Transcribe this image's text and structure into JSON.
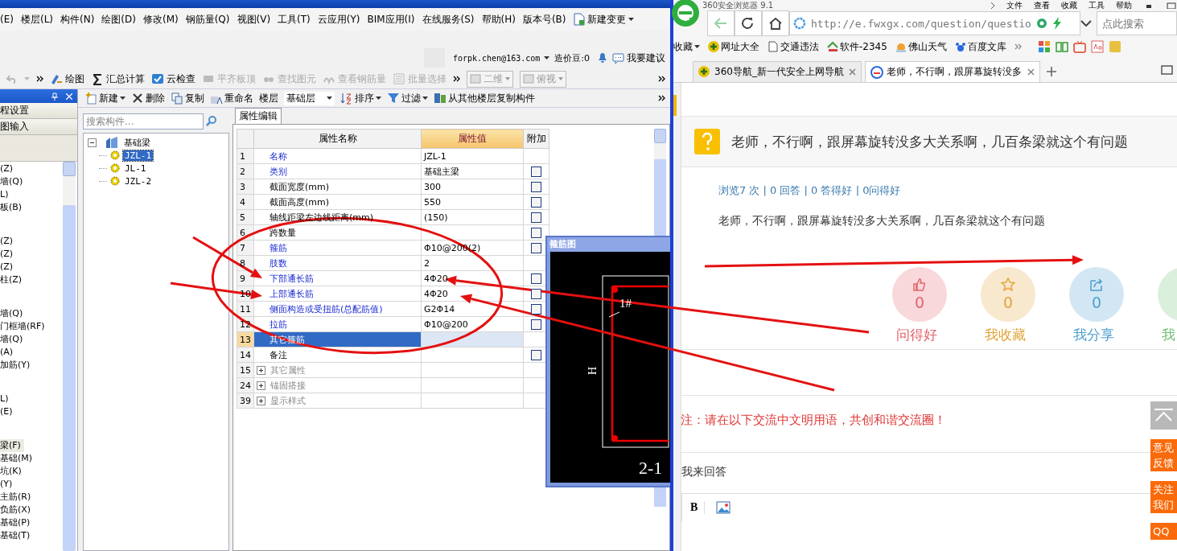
{
  "app": {
    "menu": [
      "(E)",
      "楼层(L)",
      "构件(N)",
      "绘图(D)",
      "修改(M)",
      "钢筋量(Q)",
      "视图(V)",
      "工具(T)",
      "云应用(Y)",
      "BIM应用(I)",
      "在线服务(S)",
      "帮助(H)",
      "版本号(B)"
    ],
    "menu_action": "新建变更",
    "user": {
      "email": "forpk.chen@163.com",
      "beans": "造价豆:0",
      "suggest": "我要建议"
    },
    "toolbar": [
      {
        "label": "绘图",
        "kind": "draw",
        "disabled": false
      },
      {
        "label": "汇总计算",
        "kind": "sum",
        "disabled": false
      },
      {
        "label": "云检查",
        "kind": "check",
        "disabled": false
      },
      {
        "label": "平齐板顶",
        "kind": "align",
        "disabled": true
      },
      {
        "label": "查找图元",
        "kind": "find",
        "disabled": true
      },
      {
        "label": "查看钢筋量",
        "kind": "view",
        "disabled": true
      },
      {
        "label": "批量选择",
        "kind": "batch",
        "disabled": true
      }
    ],
    "view_selects": [
      {
        "value": "二维",
        "disabled": true
      },
      {
        "value": "俯视",
        "disabled": true
      }
    ],
    "comp_toolbar": [
      {
        "label": "新建",
        "kind": "new",
        "caret": true
      },
      {
        "label": "删除",
        "kind": "delete",
        "caret": false
      },
      {
        "label": "复制",
        "kind": "copy",
        "caret": false
      },
      {
        "label": "重命名",
        "kind": "rename",
        "caret": false
      }
    ],
    "floor": {
      "label": "楼层",
      "value": "基础层"
    },
    "comp_toolbar2": [
      {
        "label": "排序",
        "kind": "sort",
        "caret": true
      },
      {
        "label": "过滤",
        "kind": "filter",
        "caret": true
      },
      {
        "label": "从其他楼层复制构件",
        "kind": "copyfloor",
        "caret": false
      }
    ],
    "nav_buttons": [
      "程设置",
      "图输入"
    ],
    "nav_groups": [
      [
        {
          "label": "(Z)",
          "selected": false
        },
        {
          "label": "墙(Q)",
          "selected": false
        },
        {
          "label": "L)",
          "selected": false
        },
        {
          "label": "板(B)",
          "selected": false
        }
      ],
      [
        {
          "label": "(Z)",
          "selected": false
        },
        {
          "label": "(Z)",
          "selected": false
        },
        {
          "label": "(Z)",
          "selected": false
        },
        {
          "label": "柱(Z)",
          "selected": false
        }
      ],
      [
        {
          "label": "墙(Q)",
          "selected": false
        },
        {
          "label": "门框墙(RF)",
          "selected": false
        },
        {
          "label": "墙(Q)",
          "selected": false
        },
        {
          "label": "(A)",
          "selected": false
        },
        {
          "label": "加筋(Y)",
          "selected": false
        }
      ],
      [
        {
          "label": "L)",
          "selected": false
        },
        {
          "label": "(E)",
          "selected": false
        }
      ],
      [
        {
          "label": "梁(F)",
          "selected": true
        },
        {
          "label": "基础(M)",
          "selected": false
        },
        {
          "label": "坑(K)",
          "selected": false
        },
        {
          "label": "(Y)",
          "selected": false
        },
        {
          "label": "主筋(R)",
          "selected": false
        },
        {
          "label": "负筋(X)",
          "selected": false
        },
        {
          "label": "基础(P)",
          "selected": false
        },
        {
          "label": "基础(T)",
          "selected": false
        }
      ]
    ],
    "search": {
      "placeholder": "搜索构件..."
    },
    "tree": {
      "label": "基础梁",
      "expanded": true,
      "children": [
        {
          "label": "JZL-1",
          "selected": true
        },
        {
          "label": "JL-1",
          "selected": false
        },
        {
          "label": "JZL-2",
          "selected": false
        }
      ]
    },
    "properties": {
      "tab": "属性编辑",
      "columns": [
        "属性名称",
        "属性值",
        "附加"
      ],
      "rows": [
        {
          "no": "1",
          "name": "名称",
          "value": "JZL-1",
          "kind": "key",
          "selected": false
        },
        {
          "no": "2",
          "name": "类别",
          "value": "基础主梁",
          "kind": "key",
          "selected": false,
          "checked": false
        },
        {
          "no": "3",
          "name": "截面宽度(mm)",
          "value": "300",
          "kind": "plain",
          "selected": false,
          "checked": false
        },
        {
          "no": "4",
          "name": "截面高度(mm)",
          "value": "550",
          "kind": "plain",
          "selected": false,
          "checked": false
        },
        {
          "no": "5",
          "name": "轴线距梁左边线距离(mm)",
          "value": "(150)",
          "kind": "plain",
          "selected": false,
          "checked": false
        },
        {
          "no": "6",
          "name": "跨数量",
          "value": "",
          "kind": "plain",
          "selected": false,
          "checked": false
        },
        {
          "no": "7",
          "name": "箍筋",
          "value": "Φ10@200(2)",
          "kind": "key",
          "selected": false,
          "checked": false
        },
        {
          "no": "8",
          "name": "肢数",
          "value": "2",
          "kind": "key",
          "selected": false
        },
        {
          "no": "9",
          "name": "下部通长筋",
          "value": "4Φ20",
          "kind": "key",
          "selected": false,
          "checked": false
        },
        {
          "no": "10",
          "name": "上部通长筋",
          "value": "4Φ20",
          "kind": "key",
          "selected": false,
          "checked": false
        },
        {
          "no": "11",
          "name": "侧面构造或受扭筋(总配筋值)",
          "value": "G2Φ14",
          "kind": "key",
          "selected": false,
          "checked": false
        },
        {
          "no": "12",
          "name": "拉筋",
          "value": "Φ10@200",
          "kind": "key",
          "selected": false,
          "checked": false
        },
        {
          "no": "13",
          "name": "其它箍筋",
          "value": "",
          "kind": "plain",
          "selected": true
        },
        {
          "no": "14",
          "name": "备注",
          "value": "",
          "kind": "plain",
          "selected": false,
          "checked": false
        },
        {
          "no": "15",
          "name": "其它属性",
          "value": "",
          "kind": "group",
          "selected": false,
          "expanded": false
        },
        {
          "no": "24",
          "name": "锚固搭接",
          "value": "",
          "kind": "group",
          "selected": false,
          "expanded": false
        },
        {
          "no": "39",
          "name": "显示样式",
          "value": "",
          "kind": "group",
          "selected": false,
          "expanded": false
        }
      ]
    },
    "stirrup": {
      "title": "箍筋图",
      "bar_label": "1#",
      "height_label": "H",
      "code": "2-1"
    }
  },
  "browser": {
    "title": "360安全浏览器 9.1",
    "menu": [
      "文件",
      "查看",
      "收藏",
      "工具",
      "帮助"
    ],
    "url": "http://e.fwxgx.com/question/questio",
    "search": {
      "placeholder": "点此搜索"
    },
    "bookmarks": [
      {
        "label": "收藏",
        "kind": "menu"
      },
      {
        "label": "网址大全",
        "kind": "nav"
      },
      {
        "label": "交通违法",
        "kind": "page"
      },
      {
        "label": "软件-2345",
        "kind": "soft"
      },
      {
        "label": "佛山天气",
        "kind": "weather"
      },
      {
        "label": "百度文库",
        "kind": "paw"
      }
    ],
    "tabs": [
      {
        "title": "360导航_新一代安全上网导航",
        "selected": false
      },
      {
        "title": "老师，不行啊，跟屏幕旋转没多",
        "selected": true
      }
    ],
    "question": {
      "title": "老师，不行啊，跟屏幕旋转没多大关系啊，几百条梁就这个有问题",
      "stats": "浏览7 次 | 0 回答 | 0 答得好 | 0问得好",
      "body": "老师，不行啊，跟屏幕旋转没多大关系啊，几百条梁就这个有问题"
    },
    "actions": [
      {
        "kind": "like",
        "count": "0",
        "label": "问得好",
        "color": "#e2636d"
      },
      {
        "kind": "star",
        "count": "0",
        "label": "我收藏",
        "color": "#e3a33a"
      },
      {
        "kind": "share",
        "count": "0",
        "label": "我分享",
        "color": "#4d9fd0"
      },
      {
        "kind": "other",
        "label": "我",
        "color": "#6cbf72"
      }
    ],
    "notice": "注：请在以下交流中文明用语，共创和谐交流圈！",
    "answer_label": "我来回答",
    "editor": [
      "B"
    ],
    "float_buttons": [
      "意见反馈",
      "关注我们",
      "QQ"
    ]
  }
}
